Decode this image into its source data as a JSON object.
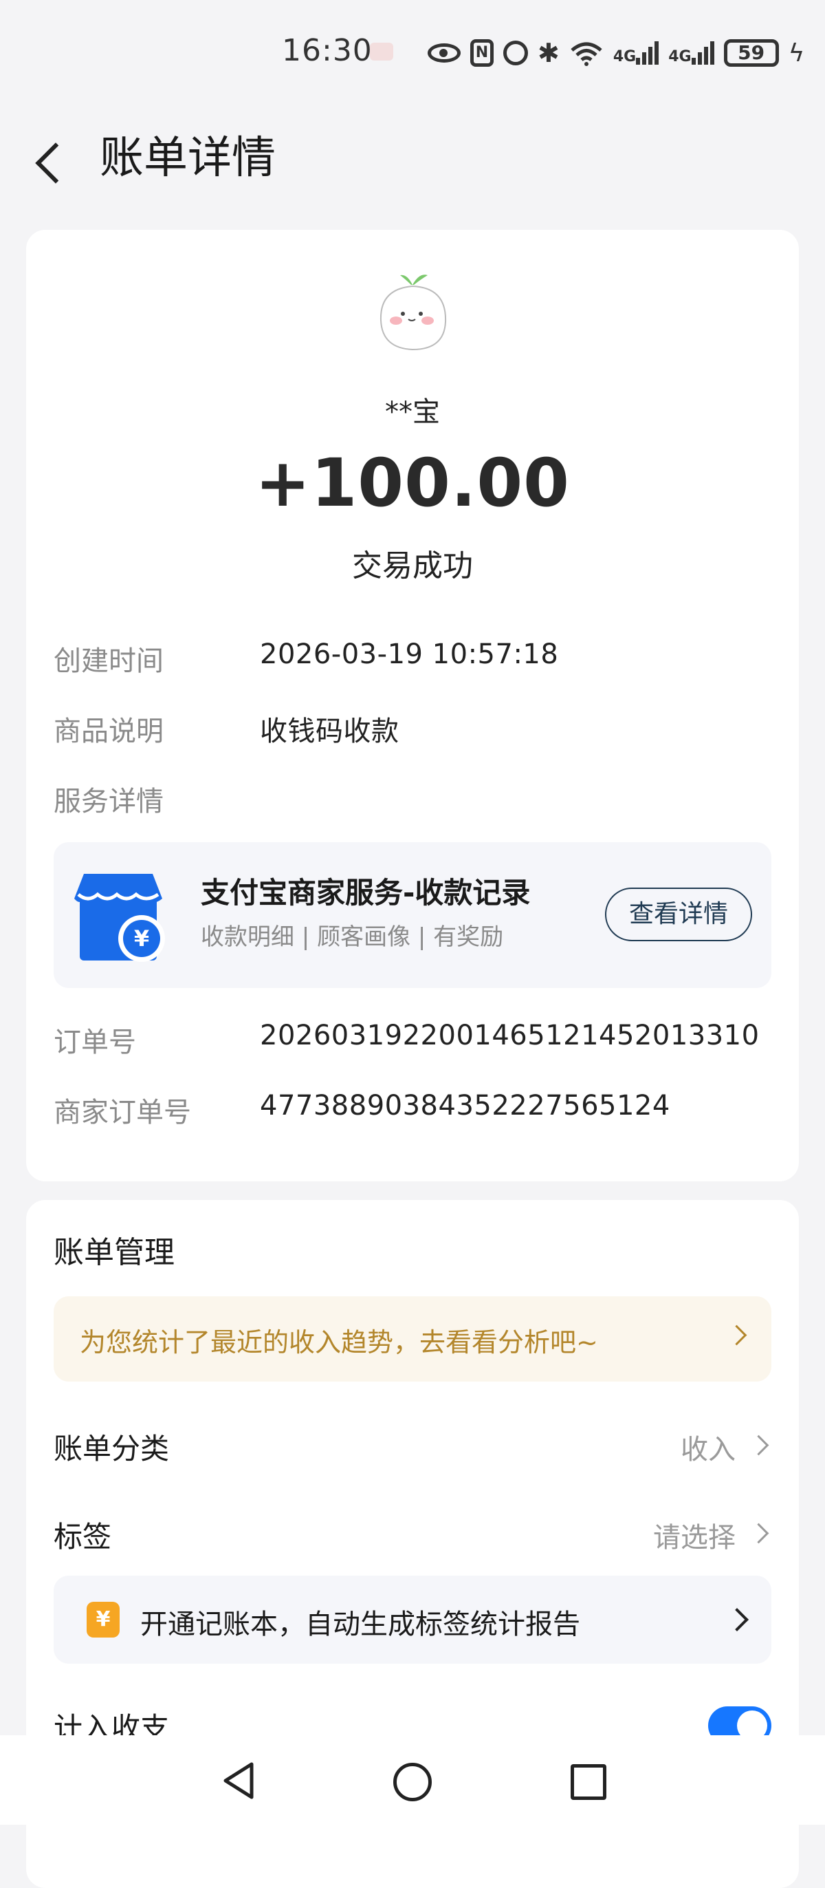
{
  "status_bar": {
    "time": "16:30",
    "network_1": "4G",
    "network_2": "4G",
    "battery": "59"
  },
  "header": {
    "title": "账单详情"
  },
  "transaction": {
    "payer": "**宝",
    "amount": "+100.00",
    "status": "交易成功",
    "rows": [
      {
        "label": "创建时间",
        "value": "2026-03-19 10:57:18"
      },
      {
        "label": "商品说明",
        "value": "收钱码收款"
      },
      {
        "label": "服务详情",
        "value": ""
      },
      {
        "label": "订单号",
        "value": "2026031922001465121452013310"
      },
      {
        "label": "商家订单号",
        "value": "477388903843522275651​24"
      }
    ],
    "service": {
      "title": "支付宝商家服务-收款记录",
      "subtitle": "收款明细 | 顾客画像 | 有奖励",
      "button": "查看详情",
      "icon_symbol": "¥"
    }
  },
  "management": {
    "title": "账单管理",
    "promo": "为您统计了最近的收入趋势，去看看分析吧~",
    "category": {
      "label": "账单分类",
      "value": "收入"
    },
    "tag": {
      "label": "标签",
      "value": "请选择"
    },
    "ledger": {
      "icon_symbol": "¥",
      "text": "开通记账本，自动生成标签统计报告"
    },
    "count_in": {
      "label": "计入收支",
      "enabled": true
    }
  },
  "colors": {
    "accent": "#1677ff",
    "promo_text": "#b3862b",
    "shop_blue": "#1a6be8"
  }
}
